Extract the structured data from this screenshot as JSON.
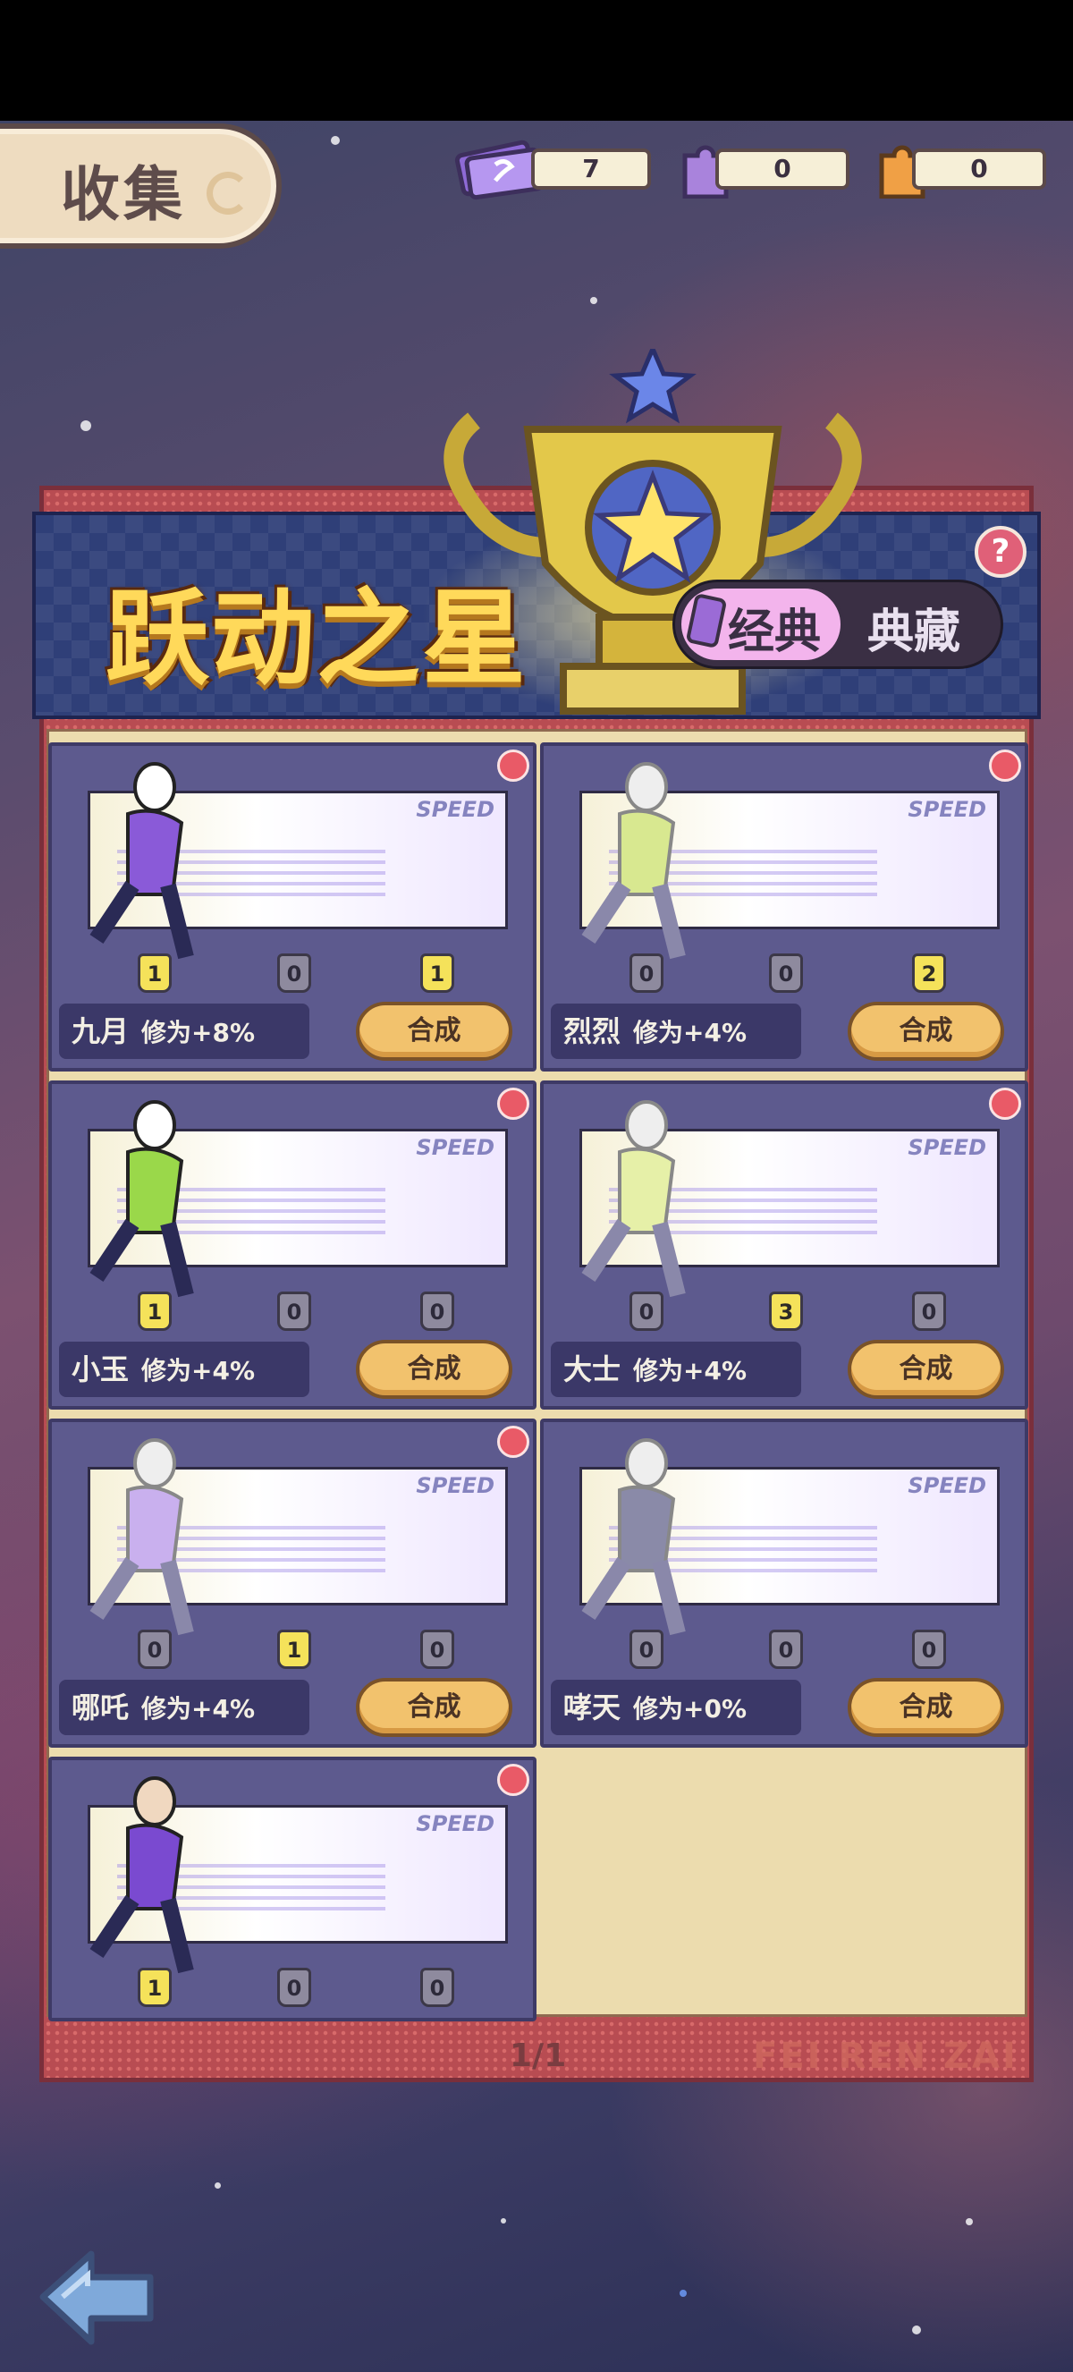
{
  "header": {
    "title": "收集",
    "resources": [
      {
        "icon": "ticket-icon",
        "value": "7"
      },
      {
        "icon": "purple-puzzle-icon",
        "value": "0"
      },
      {
        "icon": "orange-puzzle-icon",
        "value": "0"
      }
    ]
  },
  "banner": {
    "title": "跃动之星",
    "toggle_active": "经典",
    "toggle_inactive": "典藏",
    "help": "?"
  },
  "cards": [
    {
      "name": "九月",
      "bonus": "修为+8%",
      "counts": [
        "1",
        "0",
        "1"
      ],
      "button": "合成"
    },
    {
      "name": "烈烈",
      "bonus": "修为+4%",
      "counts": [
        "0",
        "0",
        "2"
      ],
      "button": "合成"
    },
    {
      "name": "小玉",
      "bonus": "修为+4%",
      "counts": [
        "1",
        "0",
        "0"
      ],
      "button": "合成"
    },
    {
      "name": "大士",
      "bonus": "修为+4%",
      "counts": [
        "0",
        "3",
        "0"
      ],
      "button": "合成"
    },
    {
      "name": "哪吒",
      "bonus": "修为+4%",
      "counts": [
        "0",
        "1",
        "0"
      ],
      "button": "合成"
    },
    {
      "name": "哮天",
      "bonus": "修为+0%",
      "counts": [
        "0",
        "0",
        "0"
      ],
      "button": "合成"
    },
    {
      "name": "",
      "bonus": "",
      "counts": [
        "1",
        "0",
        "0"
      ],
      "button": ""
    }
  ],
  "art_label": "SPEED",
  "footer": {
    "page": "1/1",
    "brand": "FEI REN ZAI"
  },
  "colors": {
    "panel_red": "#b84c52",
    "card_purple": "#5d5a8e",
    "button_gold": "#f2c26d",
    "badge_yellow": "#f5e25a"
  }
}
